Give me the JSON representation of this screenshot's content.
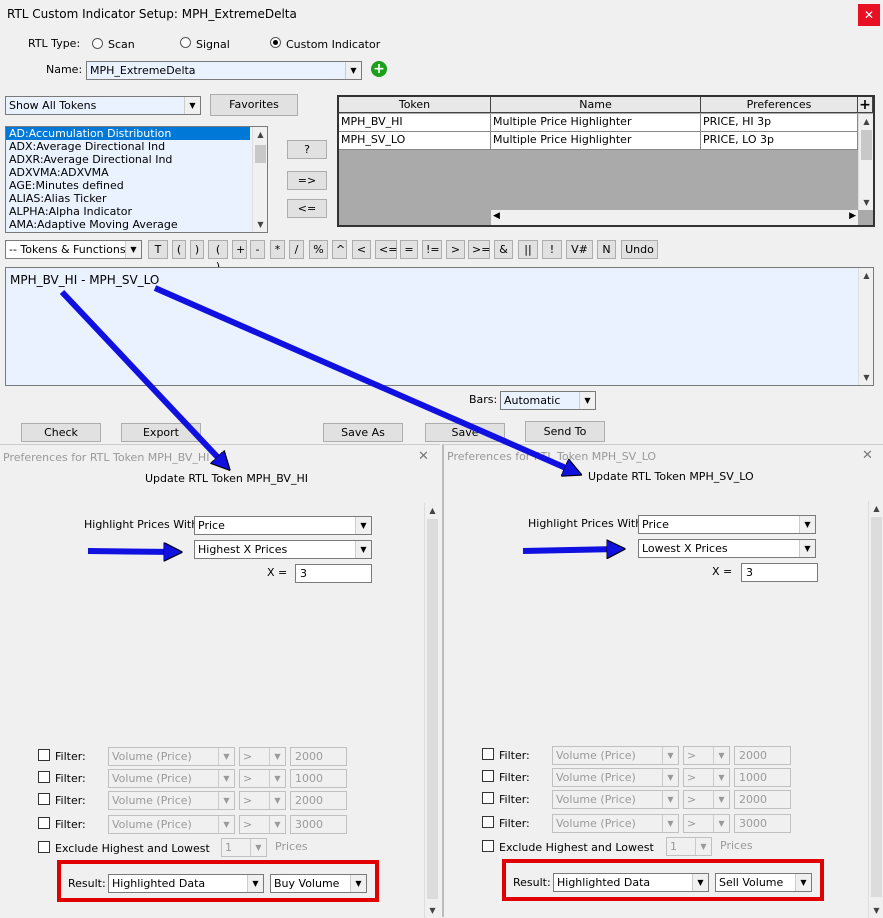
{
  "window": {
    "title": "RTL Custom Indicator Setup: MPH_ExtremeDelta",
    "close": "✕"
  },
  "rtl_type": {
    "label": "RTL Type:",
    "options": [
      "Scan",
      "Signal",
      "Custom Indicator"
    ],
    "selected": "Custom Indicator"
  },
  "name": {
    "label": "Name:",
    "value": "MPH_ExtremeDelta",
    "add_icon": "plus-circle-icon"
  },
  "tokens_filter": {
    "value": "Show All Tokens",
    "favorites": "Favorites"
  },
  "token_list": [
    "AD:Accumulation Distribution",
    "ADX:Average Directional Ind",
    "ADXR:Average Directional Ind",
    "ADXVMA:ADXVMA",
    "AGE:Minutes defined",
    "ALIAS:Alias Ticker",
    "ALPHA:Alpha Indicator",
    "AMA:Adaptive Moving Average"
  ],
  "mid_buttons": [
    "?",
    "=>",
    "<="
  ],
  "grid": {
    "headers": [
      "Token",
      "Name",
      "Preferences"
    ],
    "add": "+",
    "rows": [
      [
        "MPH_BV_HI",
        "Multiple Price Highlighter",
        "PRICE, HI 3p"
      ],
      [
        "MPH_SV_LO",
        "Multiple Price Highlighter",
        "PRICE, LO 3p"
      ]
    ]
  },
  "toolbar": {
    "functions": "-- Tokens & Functions --",
    "buttons": [
      "T",
      "(",
      ")",
      "( )",
      "+",
      "-",
      "*",
      "/",
      "%",
      "^",
      "<",
      "<=",
      "=",
      "!=",
      ">",
      ">=",
      "&",
      "||",
      "!",
      "V#",
      "N",
      "Undo"
    ]
  },
  "formula": "MPH_BV_HI - MPH_SV_LO",
  "bars": {
    "label": "Bars:",
    "value": "Automatic"
  },
  "bottom_buttons": [
    "Check",
    "Export",
    "Save As",
    "Save",
    "Send To"
  ],
  "pref_left": {
    "title": "Preferences for RTL Token MPH_BV_HI",
    "update": "Update RTL Token MPH_BV_HI",
    "highlight_label": "Highlight Prices With:",
    "highlight_value": "Price",
    "mode": "Highest X Prices",
    "x_label": "X =",
    "x_value": "3",
    "filters": [
      {
        "label": "Filter:",
        "field": "Volume (Price)",
        "op": ">",
        "value": "2000"
      },
      {
        "label": "Filter:",
        "field": "Volume (Price)",
        "op": ">",
        "value": "1000"
      },
      {
        "label": "Filter:",
        "field": "Volume (Price)",
        "op": ">",
        "value": "2000"
      },
      {
        "label": "Filter:",
        "field": "Volume (Price)",
        "op": ">",
        "value": "3000"
      }
    ],
    "exclude_label": "Exclude Highest and Lowest",
    "exclude_value": "1",
    "prices": "Prices",
    "result_label": "Result:",
    "result_value": "Highlighted Data",
    "result_type": "Buy Volume"
  },
  "pref_right": {
    "title": "Preferences for RTL Token MPH_SV_LO",
    "update": "Update RTL Token MPH_SV_LO",
    "highlight_label": "Highlight Prices With:",
    "highlight_value": "Price",
    "mode": "Lowest X Prices",
    "x_label": "X =",
    "x_value": "3",
    "filters": [
      {
        "label": "Filter:",
        "field": "Volume (Price)",
        "op": ">",
        "value": "2000"
      },
      {
        "label": "Filter:",
        "field": "Volume (Price)",
        "op": ">",
        "value": "1000"
      },
      {
        "label": "Filter:",
        "field": "Volume (Price)",
        "op": ">",
        "value": "2000"
      },
      {
        "label": "Filter:",
        "field": "Volume (Price)",
        "op": ">",
        "value": "3000"
      }
    ],
    "exclude_label": "Exclude Highest and Lowest",
    "exclude_value": "1",
    "prices": "Prices",
    "result_label": "Result:",
    "result_value": "Highlighted Data",
    "result_type": "Sell Volume"
  },
  "colors": {
    "arrow": "#1010e0",
    "highlight_box": "#e00000",
    "selection": "#0078d7",
    "add": "#1aa01a"
  }
}
